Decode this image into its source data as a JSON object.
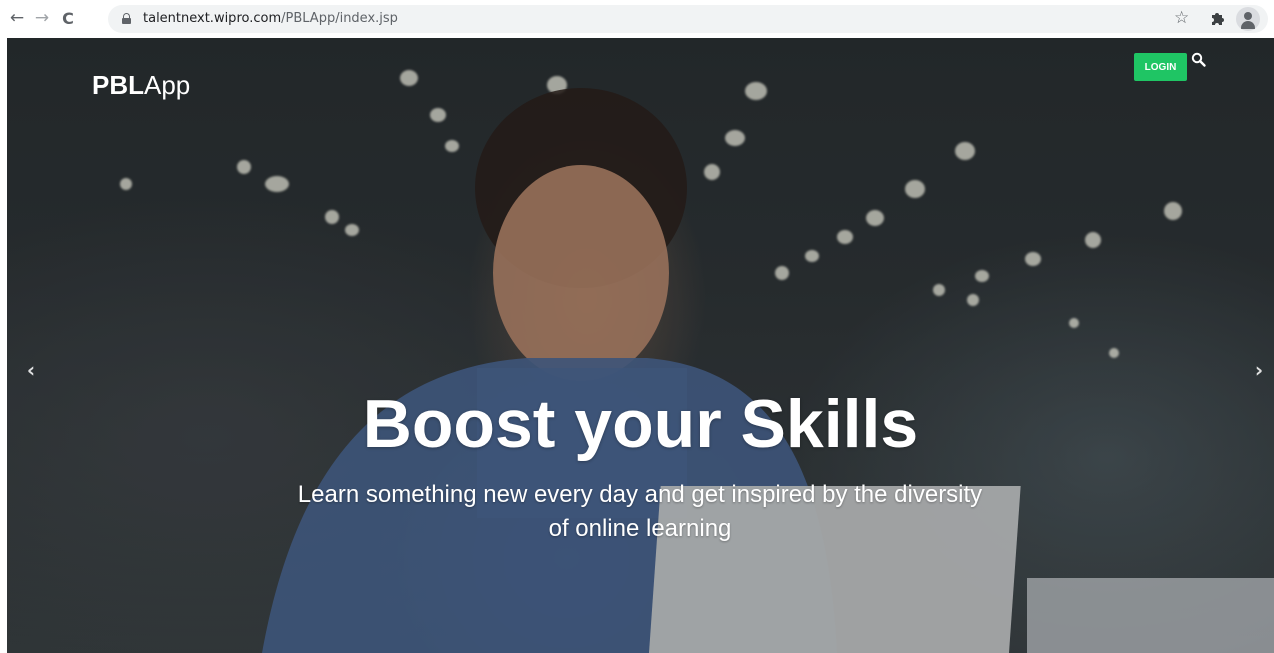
{
  "browser": {
    "back_icon": "←",
    "forward_icon": "→",
    "reload_icon": "C",
    "url_host": "talentnext.wipro.com",
    "url_path": "/PBLApp/index.jsp",
    "star_icon": "☆"
  },
  "header": {
    "brand_bold": "PBL",
    "brand_rest": "App",
    "login_label": "LOGIN"
  },
  "hero": {
    "title": "Boost your Skills",
    "subtitle": "Learn something new every day and get inspired by the diversity of online learning",
    "prev_icon": "‹",
    "next_icon": "›"
  },
  "colors": {
    "login_bg": "#1fc564",
    "text": "#ffffff"
  }
}
